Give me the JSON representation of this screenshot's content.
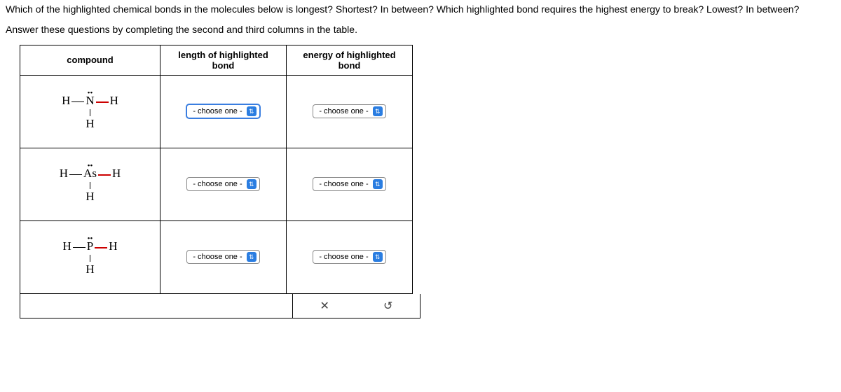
{
  "question": {
    "line1": "Which of the highlighted chemical bonds in the molecules below is longest? Shortest? In between? Which highlighted bond requires the highest energy to break? Lowest? In between?",
    "line2": "Answer these questions by completing the second and third columns in the table."
  },
  "headers": {
    "c1": "compound",
    "c2_a": "length of highlighted",
    "c2_b": "bond",
    "c3_a": "energy of highlighted",
    "c3_b": "bond"
  },
  "rows": [
    {
      "mol": {
        "left": "H",
        "center_top_dots": "••",
        "center": "N",
        "right": "H",
        "bottom": "H"
      },
      "length_sel": "- choose one -",
      "energy_sel": "- choose one -",
      "length_active": true
    },
    {
      "mol": {
        "left": "H",
        "center_top_dots": "••",
        "center": "As",
        "right": "H",
        "bottom": "H"
      },
      "length_sel": "- choose one -",
      "energy_sel": "- choose one -",
      "length_active": false
    },
    {
      "mol": {
        "left": "H",
        "center_top_dots": "••",
        "center": "P",
        "right": "H",
        "bottom": "H"
      },
      "length_sel": "- choose one -",
      "energy_sel": "- choose one -",
      "length_active": false
    }
  ],
  "icons": {
    "close": "✕",
    "reset": "↺",
    "stepper": "⇅"
  }
}
